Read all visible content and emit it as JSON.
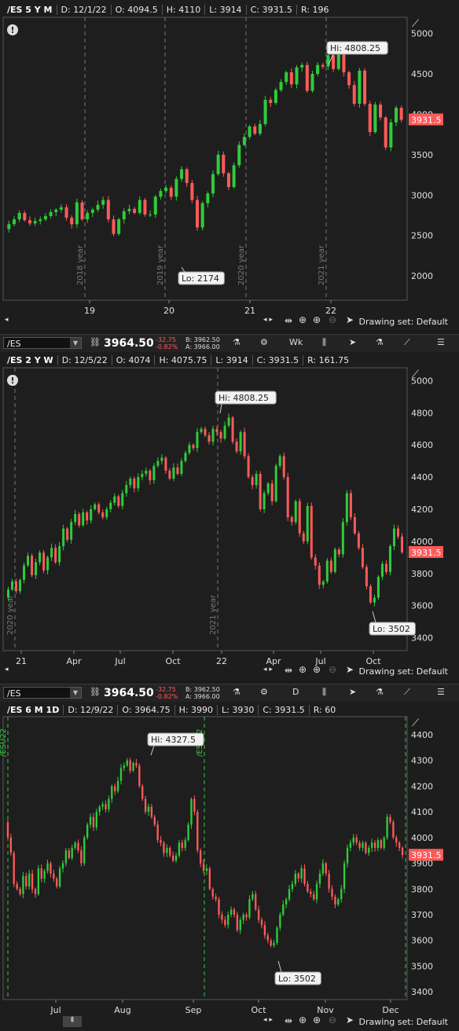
{
  "chart_data": [
    {
      "type": "candlestick",
      "symbol": "/ES",
      "period": "5 Y M",
      "header": {
        "sym": "/ES 5 Y M",
        "d": "D: 12/1/22",
        "o": "O: 4094.5",
        "h": "H: 4110",
        "l": "L: 3914",
        "c": "C: 3931.5",
        "r": "R: 196"
      },
      "x_ticks": [
        "19",
        "20",
        "21",
        "22"
      ],
      "y_ticks": [
        "5000",
        "4500",
        "4000",
        "3500",
        "3000",
        "2500",
        "2000"
      ],
      "ylim": [
        1700,
        5200
      ],
      "year_markers": [
        "2018 year",
        "2019 year",
        "2020 year",
        "2021 year"
      ],
      "annotations": {
        "hi": "Hi: 4808.25",
        "lo": "Lo: 2174"
      },
      "last_price": "3931.5",
      "closes": [
        2640,
        2700,
        2780,
        2690,
        2650,
        2680,
        2700,
        2740,
        2790,
        2820,
        2850,
        2720,
        2640,
        2910,
        2700,
        2780,
        2820,
        2880,
        2940,
        2700,
        2520,
        2700,
        2800,
        2830,
        2780,
        2940,
        2760,
        2760,
        2980,
        3050,
        3090,
        2980,
        3200,
        3320,
        3150,
        2940,
        2600,
        2900,
        3020,
        3260,
        3500,
        3270,
        3100,
        3370,
        3620,
        3720,
        3850,
        3760,
        3880,
        4180,
        4140,
        4300,
        4400,
        4520,
        4370,
        4580,
        4610,
        4290,
        4500,
        4610,
        4590,
        4730,
        4560,
        4780,
        4520,
        4360,
        4130,
        4540,
        4130,
        3780,
        4120,
        3960,
        3590,
        3900,
        4080,
        3931.5
      ],
      "series_color_up": "#2fcc3a",
      "series_color_down": "#ff5a5a"
    },
    {
      "type": "candlestick",
      "symbol": "/ES",
      "period": "2 Y W",
      "header": {
        "sym": "/ES 2 Y W",
        "d": "D: 12/5/22",
        "o": "O: 4074",
        "h": "H: 4075.75",
        "l": "L: 3914",
        "c": "C: 3931.5",
        "r": "R: 161.75"
      },
      "x_ticks": [
        "21",
        "Apr",
        "Jul",
        "Oct",
        "22",
        "Apr",
        "Jul",
        "Oct"
      ],
      "y_ticks": [
        "5000",
        "4800",
        "4600",
        "4400",
        "4200",
        "4000",
        "3800",
        "3600",
        "3400"
      ],
      "ylim": [
        3320,
        5080
      ],
      "year_markers": [
        "2020 year",
        "2021 year"
      ],
      "annotations": {
        "hi": "Hi: 4808.25",
        "lo": "Lo: 3502"
      },
      "last_price": "3931.5",
      "closes": [
        3700,
        3750,
        3690,
        3760,
        3850,
        3910,
        3790,
        3870,
        3930,
        3820,
        3900,
        3960,
        3870,
        3970,
        4080,
        4010,
        4120,
        4170,
        4100,
        4180,
        4130,
        4200,
        4230,
        4180,
        4150,
        4200,
        4240,
        4280,
        4220,
        4300,
        4350,
        4390,
        4330,
        4400,
        4420,
        4440,
        4380,
        4470,
        4500,
        4520,
        4440,
        4390,
        4460,
        4420,
        4500,
        4550,
        4600,
        4580,
        4680,
        4700,
        4660,
        4620,
        4700,
        4680,
        4640,
        4720,
        4770,
        4620,
        4560,
        4680,
        4530,
        4400,
        4350,
        4420,
        4200,
        4300,
        4360,
        4250,
        4470,
        4530,
        4400,
        4150,
        4120,
        4250,
        4050,
        4000,
        4220,
        3900,
        3850,
        3730,
        3750,
        3880,
        3810,
        3950,
        3920,
        4120,
        4300,
        4150,
        4050,
        3960,
        3840,
        3720,
        3620,
        3650,
        3780,
        3860,
        3810,
        3970,
        4080,
        4030,
        3931.5
      ],
      "series_color_up": "#2fcc3a",
      "series_color_down": "#ff5a5a"
    },
    {
      "type": "candlestick",
      "symbol": "/ES",
      "period": "6 M 1D",
      "header": {
        "sym": "/ES 6 M 1D",
        "d": "D: 12/9/22",
        "o": "O: 3964.75",
        "h": "H: 3990",
        "l": "L: 3930",
        "c": "C: 3931.5",
        "r": "R: 60"
      },
      "x_ticks": [
        "Jul",
        "Aug",
        "Sep",
        "Oct",
        "Nov",
        "Dec"
      ],
      "y_ticks": [
        "4400",
        "4300",
        "4200",
        "4100",
        "4000",
        "3900",
        "3800",
        "3700",
        "3600",
        "3500",
        "3400"
      ],
      "ylim": [
        3370,
        4470
      ],
      "contract_markers": [
        "/ESU22",
        "/ESZ22"
      ],
      "annotations": {
        "hi": "Hi: 4327.5",
        "lo": "Lo: 3502"
      },
      "last_price": "3931.5",
      "closes": [
        4000,
        3940,
        3820,
        3800,
        3780,
        3850,
        3810,
        3860,
        3800,
        3780,
        3880,
        3840,
        3870,
        3900,
        3860,
        3840,
        3810,
        3880,
        3900,
        3950,
        3920,
        3960,
        3980,
        3950,
        3900,
        4000,
        4050,
        4080,
        4040,
        4100,
        4120,
        4130,
        4110,
        4150,
        4200,
        4180,
        4220,
        4270,
        4280,
        4300,
        4260,
        4290,
        4280,
        4200,
        4150,
        4100,
        4120,
        4080,
        4050,
        3990,
        3980,
        3940,
        3960,
        3930,
        3910,
        3930,
        3980,
        3960,
        3990,
        4050,
        4150,
        4100,
        3950,
        3900,
        3870,
        3880,
        3800,
        3770,
        3760,
        3700,
        3680,
        3660,
        3700,
        3720,
        3700,
        3640,
        3680,
        3700,
        3690,
        3760,
        3780,
        3720,
        3680,
        3660,
        3620,
        3600,
        3580,
        3590,
        3650,
        3700,
        3740,
        3760,
        3800,
        3820,
        3860,
        3840,
        3880,
        3820,
        3790,
        3780,
        3760,
        3820,
        3860,
        3900,
        3860,
        3800,
        3770,
        3740,
        3760,
        3800,
        3900,
        3960,
        3980,
        4000,
        3980,
        3960,
        3980,
        3940,
        3960,
        3980,
        3960,
        3990,
        3960,
        4000,
        4080,
        4060,
        4000,
        3980,
        3960,
        3931.5
      ],
      "series_color_up": "#2fcc3a",
      "series_color_down": "#ff5a5a"
    }
  ],
  "toolbar": {
    "symbol": "/ES",
    "price": "3964.50",
    "change": "-32.75",
    "change_pct": "-0.82%",
    "bid": "B: 3962.50",
    "ask": "A: 3966.00",
    "agg1": "Wk",
    "agg2": "D"
  },
  "drawing_set": "Drawing set: Default",
  "colors": {
    "bg": "#1d1d1d",
    "grid": "#555555",
    "up": "#2fcc3a",
    "down": "#ff5a5a",
    "price_tag": "#ff5a5a",
    "contract_line": "#2fcc3a"
  }
}
